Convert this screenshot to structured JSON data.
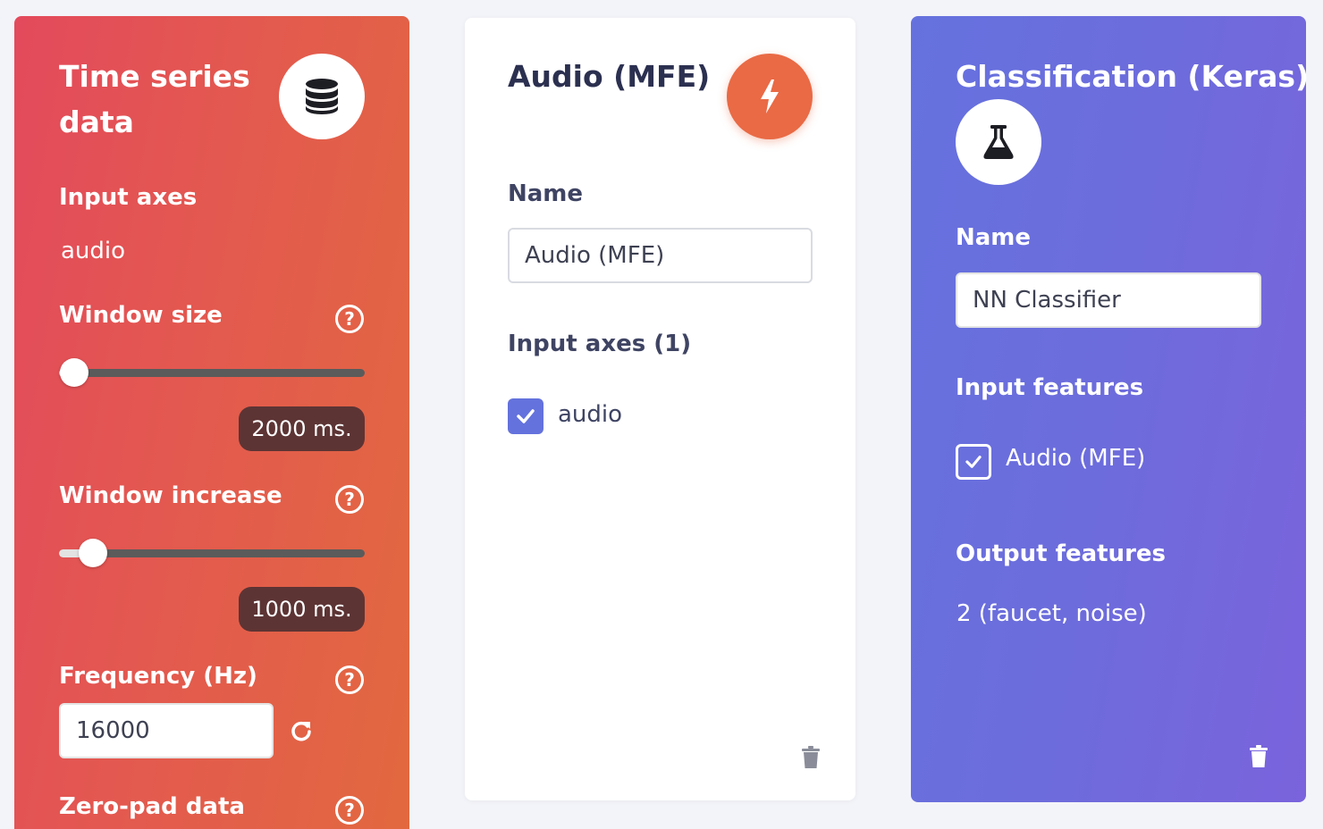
{
  "time_series": {
    "title": "Time series data",
    "input_axes_label": "Input axes",
    "input_axes_value": "audio",
    "window_size": {
      "label": "Window size",
      "value_text": "2000 ms.",
      "slider_fraction": 0.05
    },
    "window_increase": {
      "label": "Window increase",
      "value_text": "1000 ms.",
      "slider_fraction": 0.11
    },
    "frequency": {
      "label": "Frequency (Hz)",
      "value": "16000"
    },
    "zero_pad_label": "Zero-pad data",
    "help_glyph": "?",
    "icon": "database-icon"
  },
  "mfe_block": {
    "title": "Audio (MFE)",
    "name_label": "Name",
    "name_value": "Audio (MFE)",
    "input_axes_label": "Input axes (1)",
    "axes": [
      {
        "label": "audio",
        "checked": true
      }
    ],
    "icon": "lightning-icon",
    "accent": "#e96a45"
  },
  "classification_block": {
    "title": "Classification (Keras)",
    "name_label": "Name",
    "name_value": "NN Classifier",
    "input_features_label": "Input features",
    "features": [
      {
        "label": "Audio (MFE)",
        "checked": true
      }
    ],
    "output_features_label": "Output features",
    "output_features_value": "2 (faucet, noise)",
    "icon": "flask-icon"
  },
  "colors": {
    "checkbox_accent": "#6472dd",
    "background": "#f3f4f9"
  }
}
